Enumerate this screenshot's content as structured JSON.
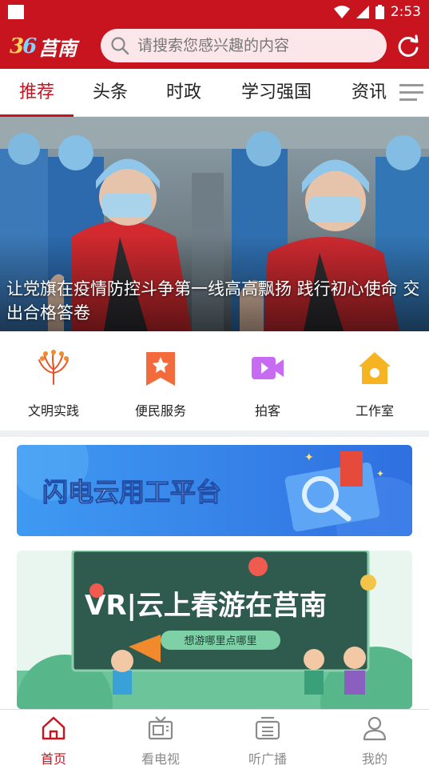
{
  "status_bar": {
    "time": "2:53"
  },
  "header": {
    "logo_text": "莒南",
    "search_placeholder": "请搜索您感兴趣的内容"
  },
  "tabs": [
    {
      "label": "推荐",
      "active": true
    },
    {
      "label": "头条",
      "active": false
    },
    {
      "label": "时政",
      "active": false
    },
    {
      "label": "学习强国",
      "active": false
    },
    {
      "label": "资讯",
      "active": false
    }
  ],
  "banner": {
    "caption": "让党旗在疫情防控斗争第一线高高飘扬 践行初心使命 交出合格答卷"
  },
  "quick_links": [
    {
      "label": "文明实践",
      "icon": "wheat-icon"
    },
    {
      "label": "便民服务",
      "icon": "star-bookmark-icon"
    },
    {
      "label": "拍客",
      "icon": "video-camera-icon"
    },
    {
      "label": "工作室",
      "icon": "home-icon"
    }
  ],
  "promo_cards": [
    {
      "title": "闪电云用工平台"
    },
    {
      "title": "VR|云上春游在莒南",
      "subtitle": "想游哪里点哪里"
    }
  ],
  "bottom_nav": [
    {
      "label": "首页",
      "active": true,
      "icon": "home-icon"
    },
    {
      "label": "看电视",
      "active": false,
      "icon": "tv-icon"
    },
    {
      "label": "听广播",
      "active": false,
      "icon": "radio-icon"
    },
    {
      "label": "我的",
      "active": false,
      "icon": "user-icon"
    }
  ],
  "colors": {
    "brand": "#c8141e",
    "search_bg": "#fbe7ea",
    "nav_inactive": "#8a8a8a"
  }
}
